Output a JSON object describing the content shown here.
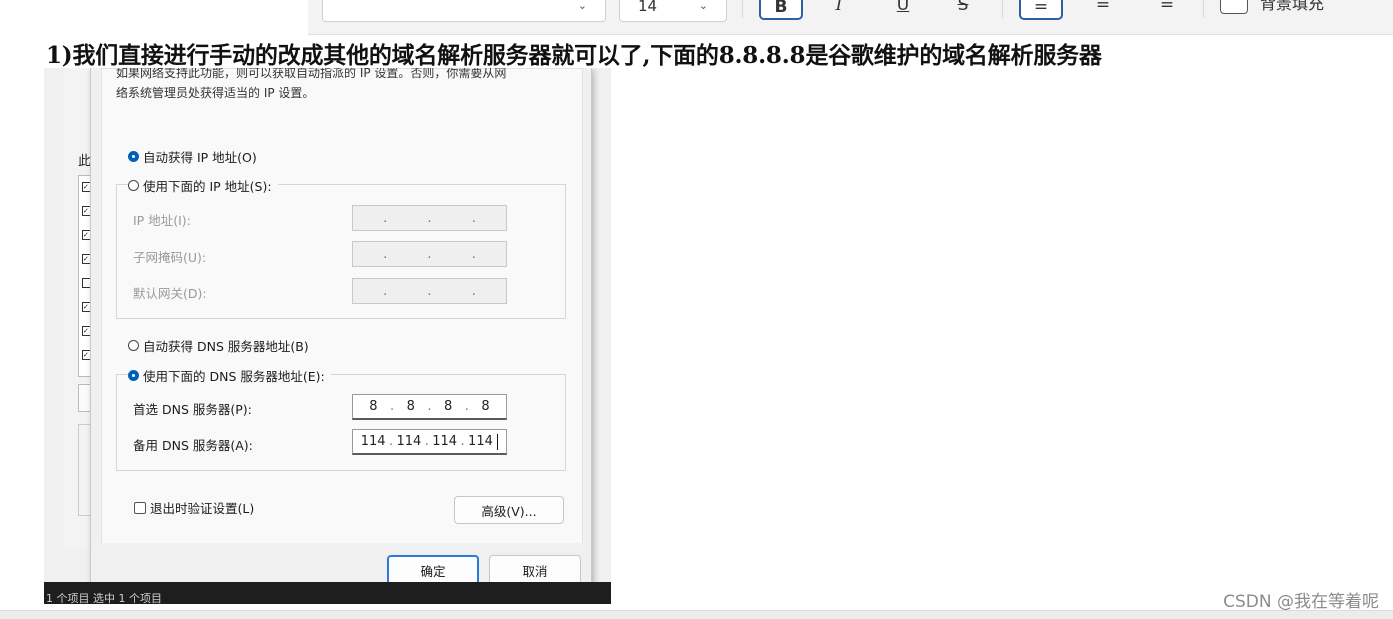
{
  "toolbar": {
    "font_size_value": "14",
    "bold_label": "B",
    "italic_label": "I",
    "underline_label": "U",
    "strike_label": "S",
    "align_left_label": "=",
    "align_center_label": "=",
    "align_right_label": "=",
    "background_fill_label": "背景填充"
  },
  "article": {
    "paragraph": "1)我们直接进行手动的改成其他的域名解析服务器就可以了,下面的8.8.8.8是谷歌维护的域名解析服务器"
  },
  "screenshot": {
    "background_window": {
      "cut_label": "此"
    },
    "dialog": {
      "description_line1": "如果网络支持此功能，则可以获取自动指派的 IP 设置。否则，你需要从网",
      "description_line2": "络系统管理员处获得适当的 IP 设置。",
      "ip_auto_label": "自动获得 IP 地址(O)",
      "ip_manual_label": "使用下面的 IP 地址(S):",
      "ip_address_label": "IP 地址(I):",
      "subnet_mask_label": "子网掩码(U):",
      "gateway_label": "默认网关(D):",
      "dns_auto_label": "自动获得 DNS 服务器地址(B)",
      "dns_manual_label": "使用下面的 DNS 服务器地址(E):",
      "preferred_dns_label": "首选 DNS 服务器(P):",
      "preferred_dns_octets": [
        "8",
        "8",
        "8",
        "8"
      ],
      "alternate_dns_label": "备用 DNS 服务器(A):",
      "alternate_dns_octets": [
        "114",
        "114",
        "114",
        "114"
      ],
      "validate_on_exit_label": "退出时验证设置(L)",
      "advanced_button": "高级(V)...",
      "ok_button": "确定",
      "cancel_button": "取消",
      "selected_ip_option": "auto",
      "selected_dns_option": "manual"
    },
    "status_bar_text": "1 个项目   选中 1 个项目"
  },
  "watermark": "CSDN @我在等着呢",
  "colors": {
    "accent": "#005fb8",
    "toolbar_active_border": "#2d5fa8"
  }
}
